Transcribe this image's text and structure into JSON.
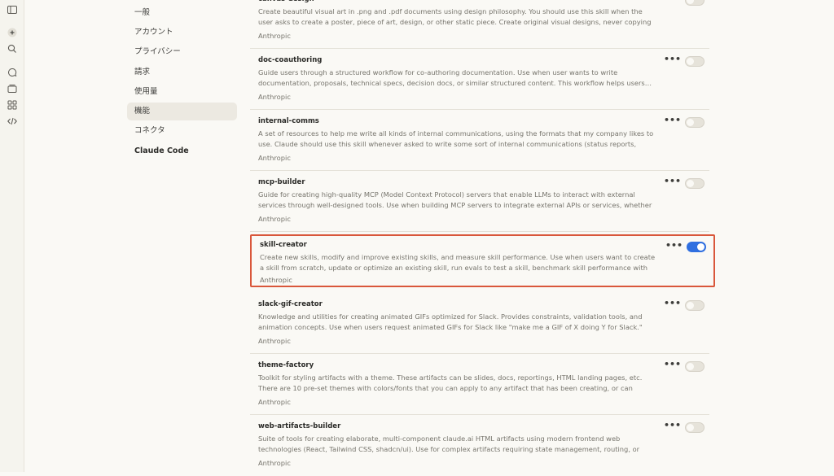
{
  "rail": {
    "icons": [
      "sidebar-toggle-icon",
      "new-chat-icon",
      "search-icon",
      "chats-icon",
      "projects-icon",
      "artifacts-icon",
      "code-icon"
    ]
  },
  "nav": {
    "items": [
      {
        "label": "一般"
      },
      {
        "label": "アカウント"
      },
      {
        "label": "プライバシー"
      },
      {
        "label": "請求"
      },
      {
        "label": "使用量"
      },
      {
        "label": "機能"
      },
      {
        "label": "コネクタ"
      },
      {
        "label": "Claude Code"
      }
    ],
    "active_index": 5
  },
  "skills": [
    {
      "name": "canvas-design",
      "desc": "Create beautiful visual art in .png and .pdf documents using design philosophy. You should use this skill when the user asks to create a poster, piece of art, design, or other static piece. Create original visual designs, never copying existing…",
      "author": "Anthropic",
      "enabled": false
    },
    {
      "name": "doc-coauthoring",
      "desc": "Guide users through a structured workflow for co-authoring documentation. Use when user wants to write documentation, proposals, technical specs, decision docs, or similar structured content. This workflow helps users…",
      "author": "Anthropic",
      "enabled": false
    },
    {
      "name": "internal-comms",
      "desc": "A set of resources to help me write all kinds of internal communications, using the formats that my company likes to use. Claude should use this skill whenever asked to write some sort of internal communications (status reports, leadership…",
      "author": "Anthropic",
      "enabled": false
    },
    {
      "name": "mcp-builder",
      "desc": "Guide for creating high-quality MCP (Model Context Protocol) servers that enable LLMs to interact with external services through well-designed tools. Use when building MCP servers to integrate external APIs or services, whether in Python…",
      "author": "Anthropic",
      "enabled": false
    },
    {
      "name": "skill-creator",
      "desc": "Create new skills, modify and improve existing skills, and measure skill performance. Use when users want to create a skill from scratch, update or optimize an existing skill, run evals to test a skill, benchmark skill performance with variance…",
      "author": "Anthropic",
      "enabled": true
    },
    {
      "name": "slack-gif-creator",
      "desc": "Knowledge and utilities for creating animated GIFs optimized for Slack. Provides constraints, validation tools, and animation concepts. Use when users request animated GIFs for Slack like \"make me a GIF of X doing Y for Slack.\"",
      "author": "Anthropic",
      "enabled": false
    },
    {
      "name": "theme-factory",
      "desc": "Toolkit for styling artifacts with a theme. These artifacts can be slides, docs, reportings, HTML landing pages, etc. There are 10 pre-set themes with colors/fonts that you can apply to any artifact that has been creating, or can generate a new…",
      "author": "Anthropic",
      "enabled": false
    },
    {
      "name": "web-artifacts-builder",
      "desc": "Suite of tools for creating elaborate, multi-component claude.ai HTML artifacts using modern frontend web technologies (React, Tailwind CSS, shadcn/ui). Use for complex artifacts requiring state management, routing, or shadcn/ui componen…",
      "author": "Anthropic",
      "enabled": false
    }
  ],
  "colors": {
    "accent": "#2f6fe0",
    "highlight_border": "#d9573b",
    "background": "#faf9f5"
  }
}
